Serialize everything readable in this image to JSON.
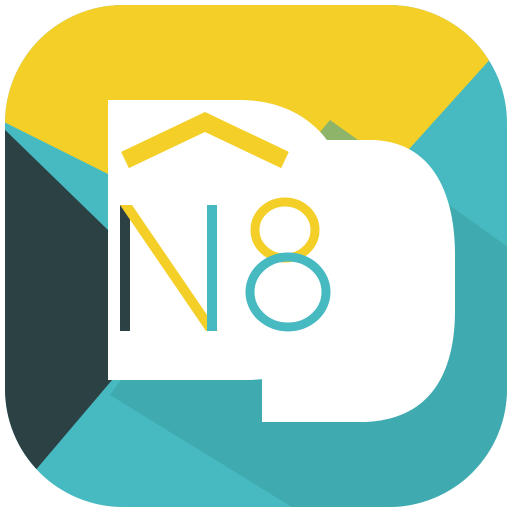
{
  "logo": {
    "name": "N8D app icon",
    "letters": "N8",
    "colors": {
      "yellow": "#F3CF27",
      "teal": "#46BAC0",
      "teal_shadow": "#3A9EA2",
      "dark": "#2B4144",
      "white": "#FFFFFF"
    },
    "icon": "n8d-logo-icon"
  }
}
